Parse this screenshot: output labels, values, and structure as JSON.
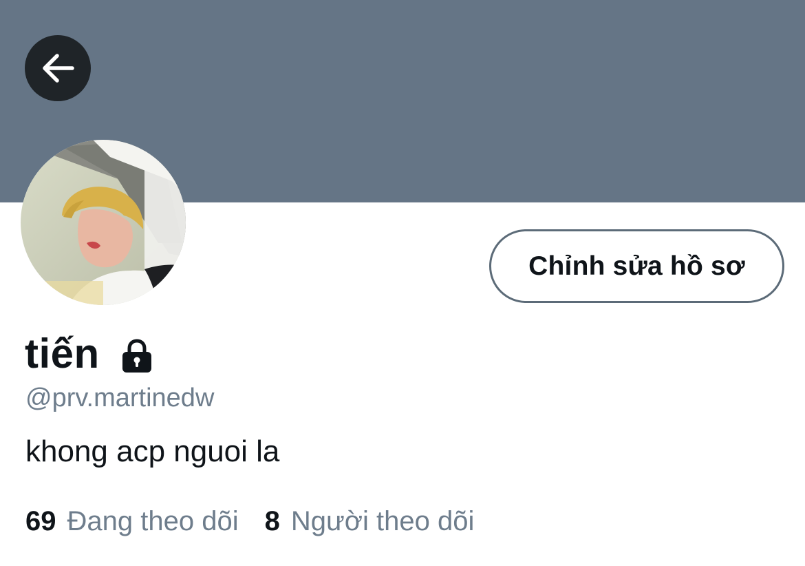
{
  "header": {
    "banner_color": "#657586",
    "back_icon": "arrow-left-icon"
  },
  "profile": {
    "avatar": "profile-photo",
    "edit_button_label": "Chỉnh sửa hồ sơ",
    "display_name": "tiến",
    "protected_icon": "lock-icon",
    "handle": "@prv.martinedw",
    "bio": "khong acp nguoi la"
  },
  "stats": {
    "following_count": "69",
    "following_label": "Đang theo dõi",
    "followers_count": "8",
    "followers_label": "Người theo dõi"
  }
}
